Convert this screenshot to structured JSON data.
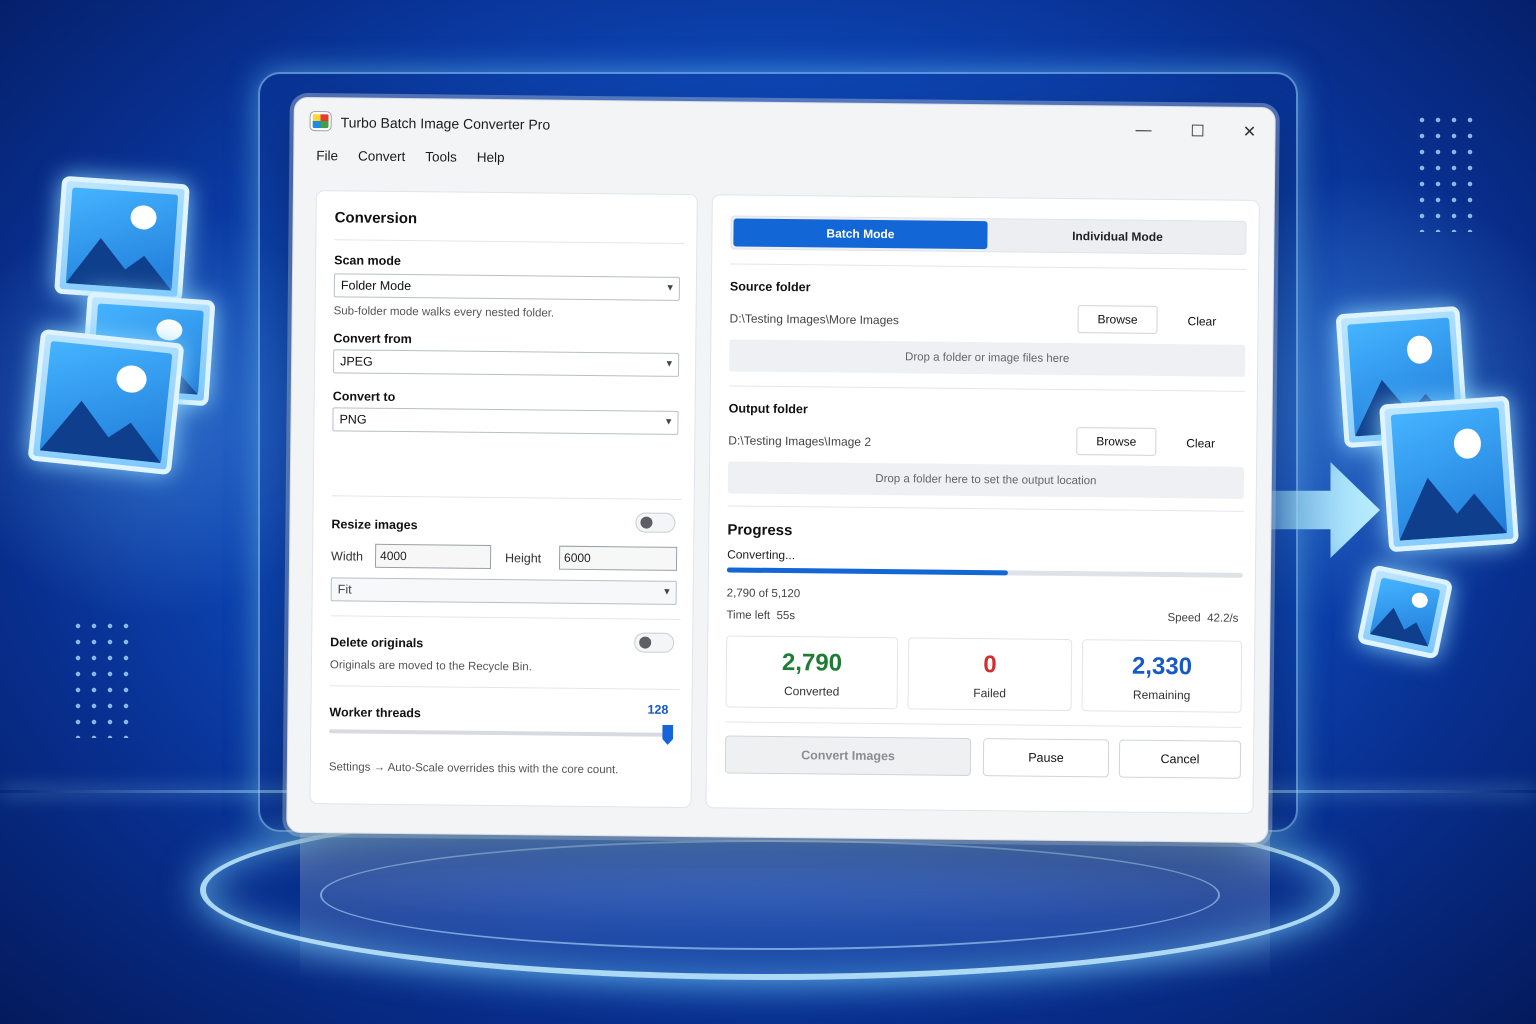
{
  "window": {
    "title": "Turbo Batch Image Converter Pro",
    "minimize_glyph": "—",
    "maximize_glyph": "☐",
    "close_glyph": "✕"
  },
  "menu": [
    "File",
    "Convert",
    "Tools",
    "Help"
  ],
  "conversion": {
    "heading": "Conversion",
    "scan_mode_label": "Scan mode",
    "scan_mode_value": "Folder Mode",
    "scan_mode_hint": "Sub-folder mode walks every nested folder.",
    "convert_from_label": "Convert from",
    "convert_from_value": "JPEG",
    "convert_to_label": "Convert to",
    "convert_to_value": "PNG",
    "resize_label": "Resize images",
    "resize_enabled": false,
    "width_label": "Width",
    "width_value": "4000",
    "height_label": "Height",
    "height_value": "6000",
    "fit_value": "Fit",
    "delete_label": "Delete originals",
    "delete_enabled": false,
    "delete_hint": "Originals are moved to the Recycle Bin.",
    "threads_label": "Worker threads",
    "threads_value": "128",
    "threads_fraction": 1.0,
    "threads_hint": "Settings → Auto-Scale overrides this with the core count."
  },
  "modes": {
    "batch": "Batch Mode",
    "individual": "Individual Mode",
    "active": "batch"
  },
  "source": {
    "label": "Source folder",
    "path": "D:\\Testing Images\\More Images",
    "browse": "Browse",
    "clear": "Clear",
    "drop_hint": "Drop a folder or image files here"
  },
  "output": {
    "label": "Output folder",
    "path": "D:\\Testing Images\\Image 2",
    "browse": "Browse",
    "clear": "Clear",
    "drop_hint": "Drop a folder here to set the output location"
  },
  "progress": {
    "heading": "Progress",
    "status": "Converting...",
    "fraction": 0.545,
    "count_text": "2,790 of 5,120",
    "time_left_label": "Time left",
    "time_left_value": "55s",
    "speed_label": "Speed",
    "speed_value": "42.2/s"
  },
  "stats": [
    {
      "value": "2,790",
      "label": "Converted",
      "color": "#1e7d32"
    },
    {
      "value": "0",
      "label": "Failed",
      "color": "#d32f2f"
    },
    {
      "value": "2,330",
      "label": "Remaining",
      "color": "#1659c7"
    }
  ],
  "actions": {
    "convert": "Convert Images",
    "pause": "Pause",
    "cancel": "Cancel"
  },
  "icons": {
    "app": "app-logo-icon",
    "chevron": "▾"
  }
}
